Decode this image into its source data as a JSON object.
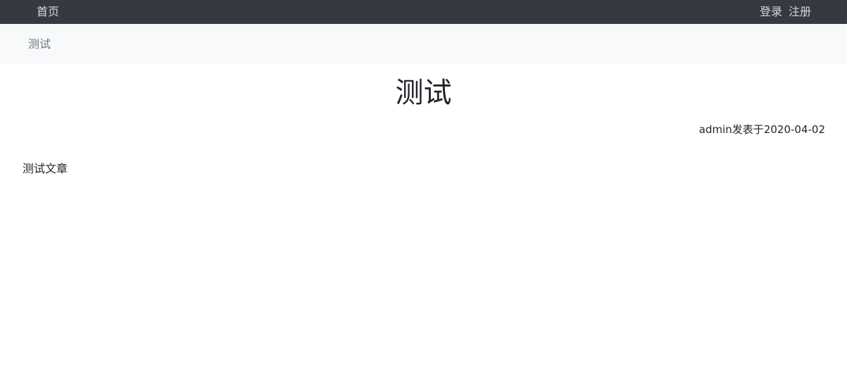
{
  "nav": {
    "home": "首页",
    "login": "登录",
    "register": "注册"
  },
  "breadcrumb": {
    "current": "测试"
  },
  "article": {
    "title": "测试",
    "author": "admin",
    "published_text": "发表于",
    "date": "2020-04-02",
    "body": "测试文章"
  }
}
